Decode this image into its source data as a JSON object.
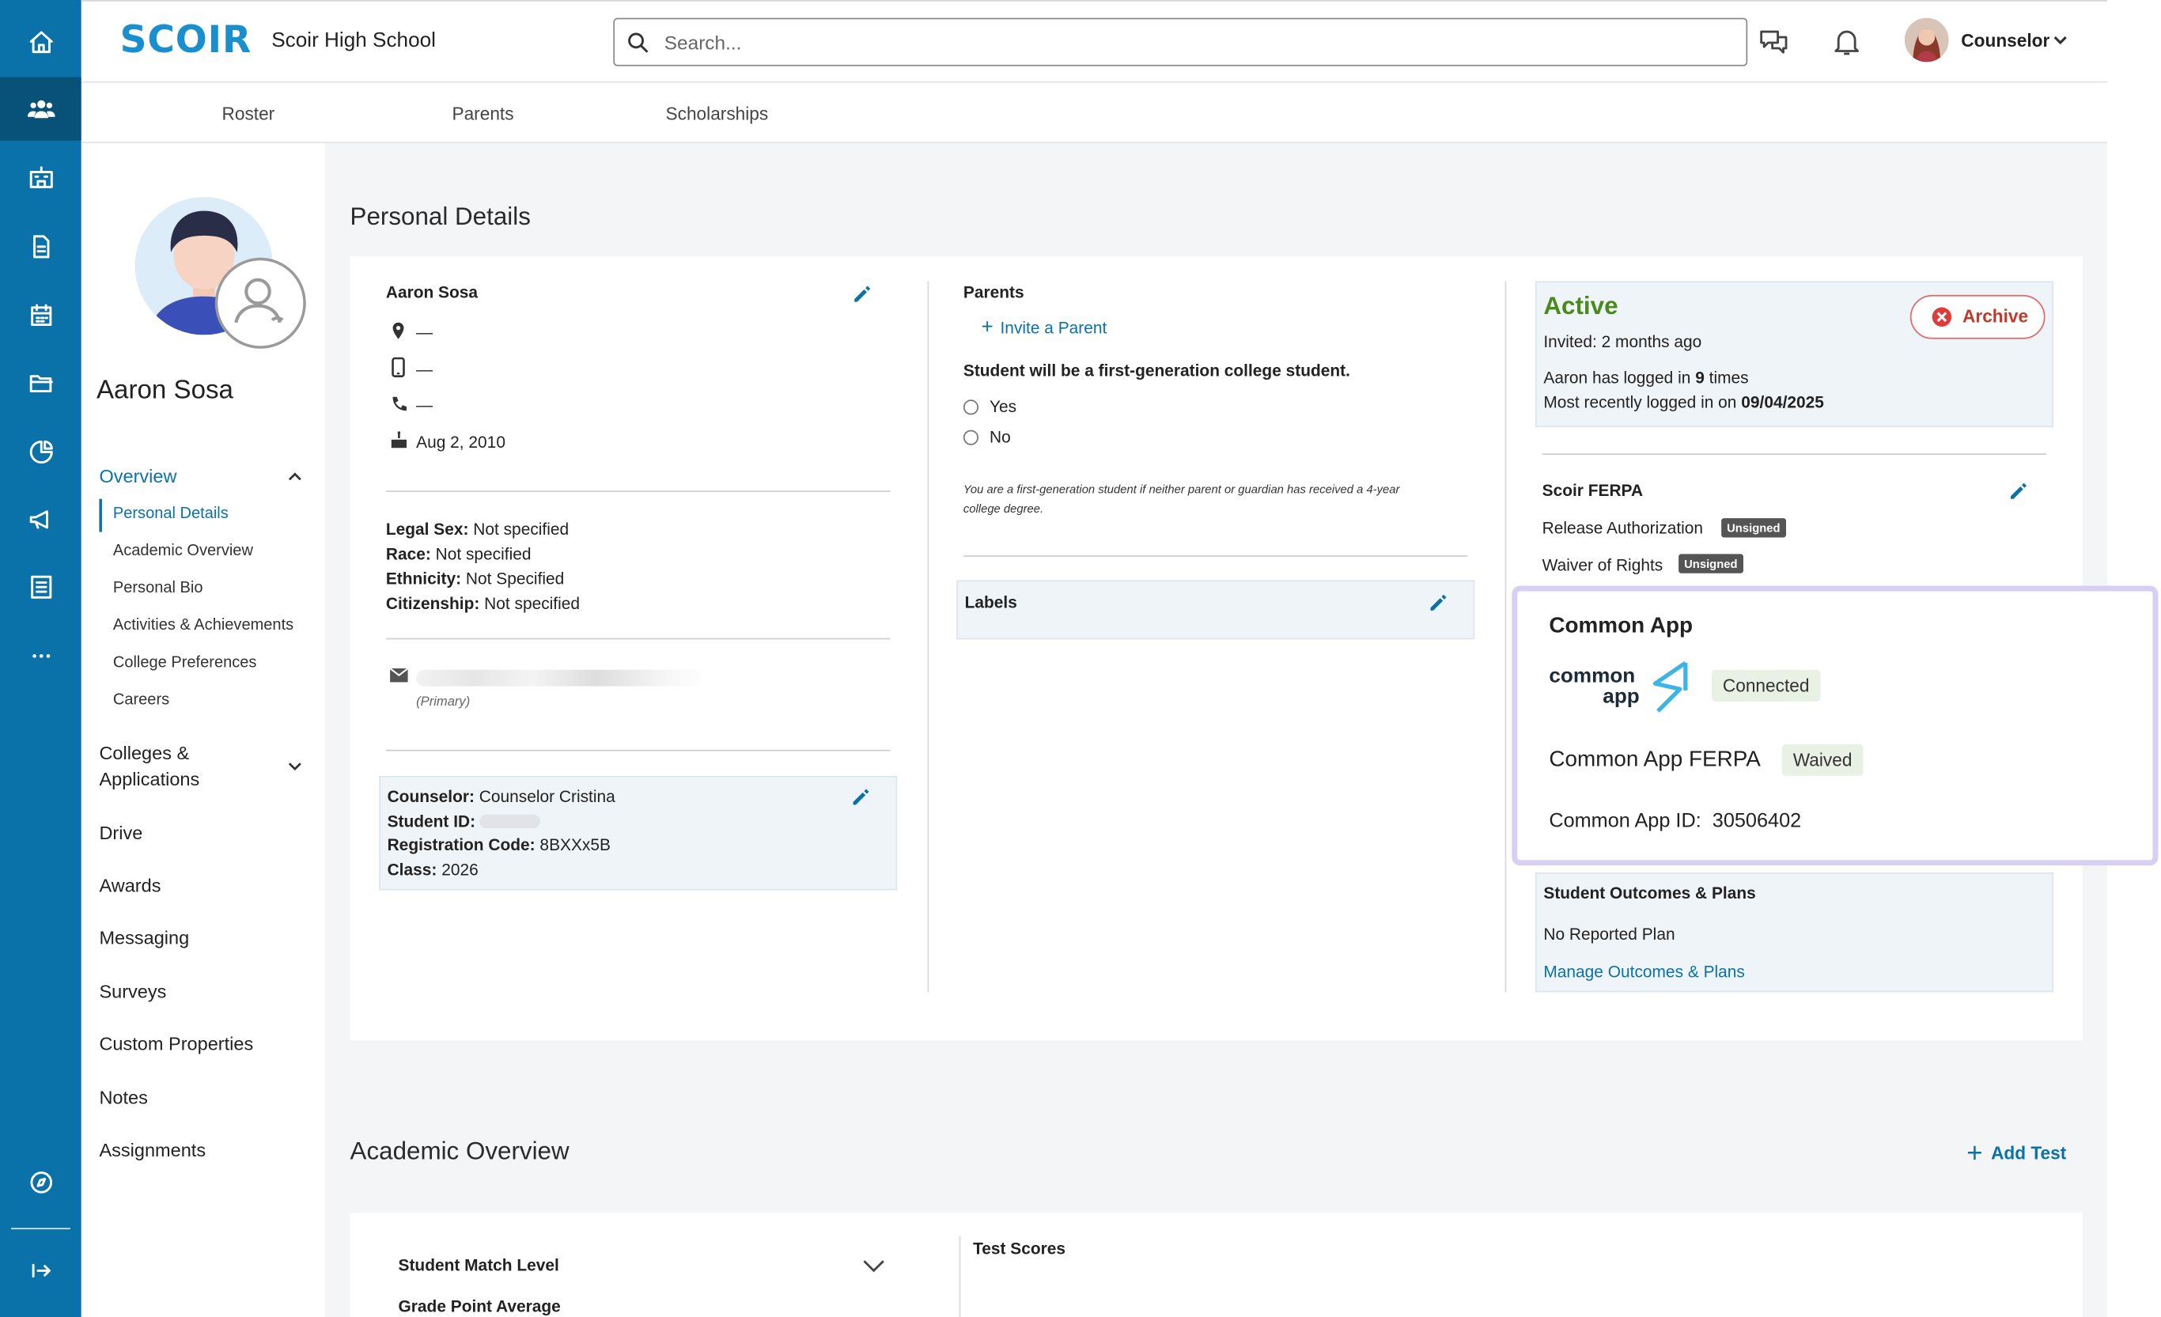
{
  "app": {
    "logo": "SCOIR",
    "school": "Scoir High School",
    "search_placeholder": "Search...",
    "user_menu_label": "Counselor"
  },
  "rail_icons": [
    "home-icon",
    "students-icon",
    "institution-icon",
    "document-icon",
    "calendar-icon",
    "folder-icon",
    "analytics-icon",
    "megaphone-icon",
    "checklist-icon",
    "more-icon",
    "compass-icon",
    "expand-icon"
  ],
  "top_tabs": [
    "Roster",
    "Parents",
    "Scholarships"
  ],
  "sidebar": {
    "student_name": "Aaron Sosa",
    "overview_label": "Overview",
    "overview_items": [
      "Personal Details",
      "Academic Overview",
      "Personal Bio",
      "Activities & Achievements",
      "College Preferences",
      "Careers"
    ],
    "colleges_label_line1": "Colleges &",
    "colleges_label_line2": "Applications",
    "items": [
      "Drive",
      "Awards",
      "Messaging",
      "Surveys",
      "Custom Properties",
      "Notes",
      "Assignments"
    ]
  },
  "personal_details": {
    "title": "Personal Details",
    "name": "Aaron Sosa",
    "location": "—",
    "mobile": "—",
    "phone": "—",
    "birthday": "Aug 2, 2010",
    "legal_sex_label": "Legal Sex:",
    "legal_sex": "Not specified",
    "race_label": "Race:",
    "race": "Not specified",
    "ethnicity_label": "Ethnicity:",
    "ethnicity": "Not Specified",
    "citizenship_label": "Citizenship:",
    "citizenship": "Not specified",
    "email_note": "(Primary)",
    "counselor_label": "Counselor:",
    "counselor": "Counselor Cristina",
    "student_id_label": "Student ID:",
    "registration_label": "Registration Code:",
    "registration_code": "8BXXx5B",
    "class_label": "Class:",
    "class_year": "2026"
  },
  "parents": {
    "title": "Parents",
    "invite": "Invite a Parent",
    "first_gen_question": "Student will be a first-generation college student.",
    "yes": "Yes",
    "no": "No",
    "first_gen_note_line1": "You are a first-generation student if neither parent or guardian has received a 4-year",
    "first_gen_note_line2": "college degree.",
    "labels_title": "Labels"
  },
  "status": {
    "state": "Active",
    "invited": "Invited: 2 months ago",
    "login_prefix": "Aaron has logged in ",
    "login_count": "9",
    "login_suffix": " times",
    "recent_prefix": "Most recently logged in on ",
    "recent_date": "09/04/2025",
    "archive": "Archive"
  },
  "ferpa": {
    "title": "Scoir FERPA",
    "release": "Release Authorization",
    "release_status": "Unsigned",
    "waiver": "Waiver of Rights",
    "waiver_status": "Unsigned"
  },
  "common_app": {
    "title": "Common App",
    "logo_line1": "common",
    "logo_line2": "app",
    "connection_status": "Connected",
    "ferpa_label": "Common App FERPA",
    "ferpa_status": "Waived",
    "id_label": "Common App ID:",
    "id_value": "30506402"
  },
  "outcomes": {
    "title": "Student Outcomes & Plans",
    "status": "No Reported Plan",
    "manage": "Manage Outcomes & Plans"
  },
  "academic": {
    "title": "Academic Overview",
    "add_test": "Add Test",
    "match_level": "Student Match Level",
    "gpa": "Grade Point Average",
    "test_scores": "Test Scores"
  },
  "colors": {
    "brand": "#0a72a8",
    "active_green": "#4a8a1c",
    "highlight_border": "#d8d0f4"
  }
}
